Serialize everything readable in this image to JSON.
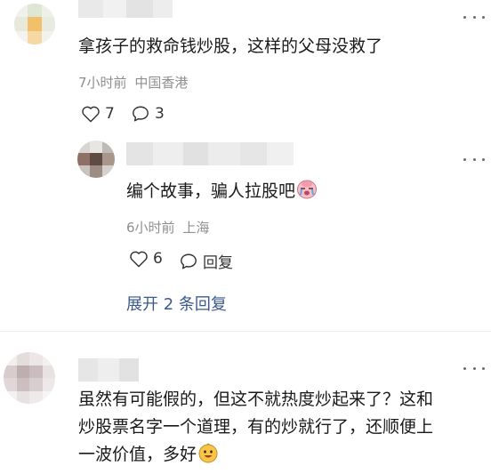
{
  "comment1": {
    "text": "拿孩子的救命钱炒股，这样的父母没救了",
    "time": "7小时前",
    "location": "中国香港",
    "likes": "7",
    "replies": "3"
  },
  "reply1": {
    "text": "编个故事，骗人拉股吧",
    "emoji": "crying-face-icon",
    "time": "6小时前",
    "location": "上海",
    "likes": "6",
    "reply_label": "回复"
  },
  "expand_label": "展开 2 条回复",
  "comment2": {
    "line1": "虽然有可能假的，但这不就热度炒起来了？这和",
    "line2": "炒股票名字一个道理，有的炒就行了，还顺便上",
    "line3": "一波价值，多好",
    "emoji": "grinning-face-icon"
  },
  "colors": {
    "text": "#1a1a1a",
    "meta": "#8f8f8f",
    "link": "#3b5a8c"
  }
}
